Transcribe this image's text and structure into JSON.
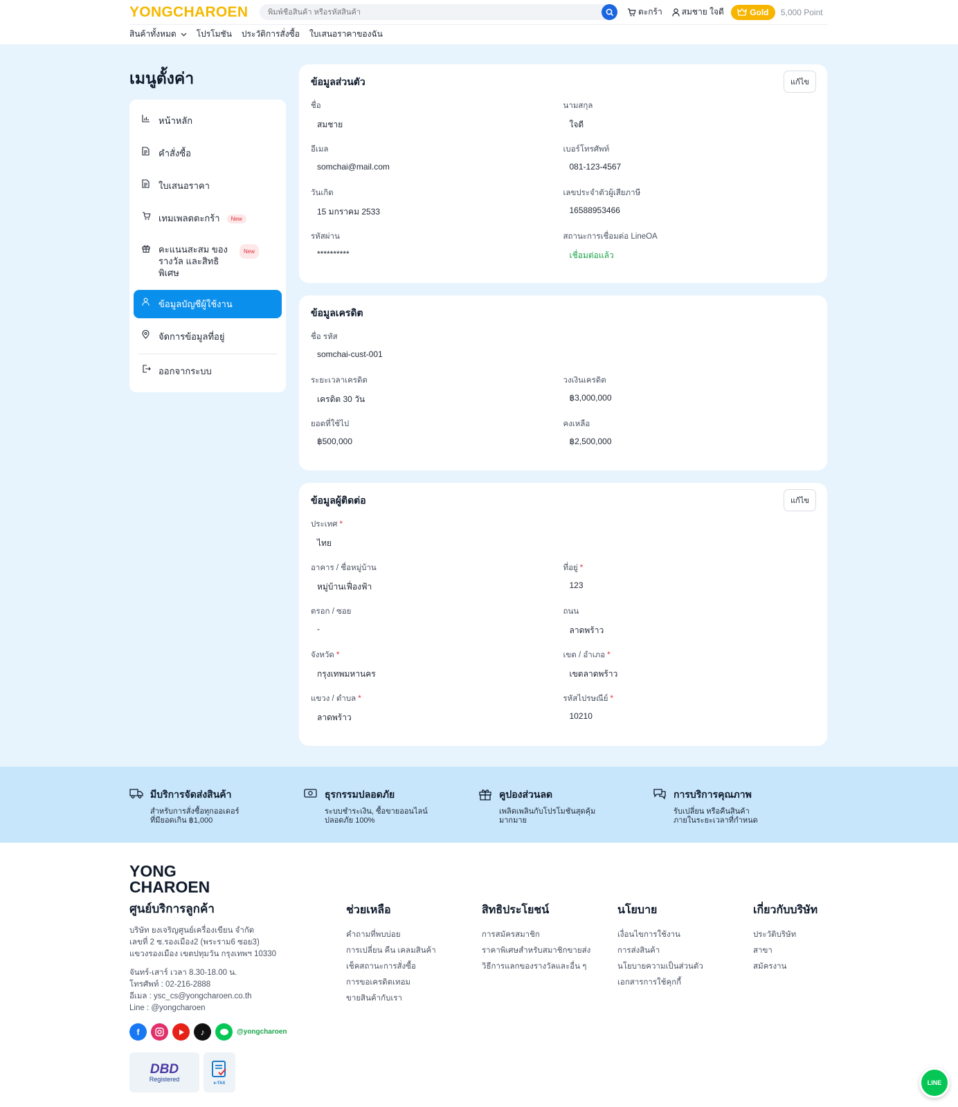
{
  "header": {
    "logo": "YONGCHAROEN",
    "search_placeholder": "พิมพ์ชื่อสินค้า หรือรหัสสินค้า",
    "cart_label": "ตะกร้า",
    "user_name": "สมชาย ใจดี",
    "tier": "Gold",
    "points": "5,000 Point",
    "nav": [
      "สินค้าทั้งหมด",
      "โปรโมชัน",
      "ประวัติการสั่งซื้อ",
      "ใบเสนอราคาของฉัน"
    ]
  },
  "sidebar": {
    "title": "เมนูตั้งค่า",
    "items": [
      {
        "label": "หน้าหลัก"
      },
      {
        "label": "คำสั่งซื้อ"
      },
      {
        "label": "ใบเสนอราคา"
      },
      {
        "label": "เทมเพลตตะกร้า",
        "badge": "New"
      },
      {
        "label": "คะแนนสะสม ของรางวัล และสิทธิพิเศษ",
        "badge": "New"
      },
      {
        "label": "ข้อมูลบัญชีผู้ใช้งาน"
      },
      {
        "label": "จัดการข้อมูลที่อยู่"
      },
      {
        "label": "ออกจากระบบ"
      }
    ]
  },
  "personal": {
    "title": "ข้อมูลส่วนตัว",
    "edit": "แก้ไข",
    "fields": [
      {
        "label": "ชื่อ",
        "value": "สมชาย"
      },
      {
        "label": "นามสกุล",
        "value": "ใจดี"
      },
      {
        "label": "อีเมล",
        "value": "somchai@mail.com"
      },
      {
        "label": "เบอร์โทรศัพท์",
        "value": "081-123-4567"
      },
      {
        "label": "วันเกิด",
        "value": "15 มกราคม 2533"
      },
      {
        "label": "เลขประจำตัวผู้เสียภาษี",
        "value": "16588953466"
      },
      {
        "label": "รหัสผ่าน",
        "value": "**********"
      },
      {
        "label": "สถานะการเชื่อมต่อ LineOA",
        "value": "เชื่อมต่อแล้ว"
      }
    ]
  },
  "credit": {
    "title": "ข้อมูลเครดิต",
    "fields": [
      {
        "label": "ชื่อ รหัส",
        "value": "somchai-cust-001"
      },
      {
        "label": "ระยะเวลาเครดิต",
        "value": "เครดิต 30 วัน"
      },
      {
        "label": "วงเงินเครดิต",
        "value": "฿3,000,000"
      },
      {
        "label": "ยอดที่ใช้ไป",
        "value": "฿500,000"
      },
      {
        "label": "คงเหลือ",
        "value": "฿2,500,000"
      }
    ]
  },
  "contact": {
    "title": "ข้อมูลผู้ติดต่อ",
    "edit": "แก้ไข",
    "required_mark": "*",
    "fields": [
      {
        "label": "ประเทศ",
        "value": "ไทย"
      },
      {
        "label": "อาคาร / ชื่อหมู่บ้าน",
        "value": "หมู่บ้านเฟื่องฟ้า"
      },
      {
        "label": "ที่อยู่",
        "value": "123"
      },
      {
        "label": "ตรอก / ซอย",
        "value": "-"
      },
      {
        "label": "ถนน",
        "value": "ลาดพร้าว"
      },
      {
        "label": "จังหวัด",
        "value": "กรุงเทพมหานคร"
      },
      {
        "label": "เขต / อำเภอ",
        "value": "เขตลาดพร้าว"
      },
      {
        "label": "แขวง / ตำบล",
        "value": "ลาดพร้าว"
      },
      {
        "label": "รหัสไปรษณีย์",
        "value": "10210"
      }
    ]
  },
  "features": [
    {
      "title": "มีบริการจัดส่งสินค้า",
      "line1": "สำหรับการสั่งซื้อทุกออเดอร์",
      "line2": "ที่มียอดเกิน ฿1,000"
    },
    {
      "title": "ธุรกรรมปลอดภัย",
      "line1": "ระบบชำระเงิน, ซื้อขายออนไลน์",
      "line2": "ปลอดภัย 100%"
    },
    {
      "title": "คูปองส่วนลด",
      "line1": "เพลิดเพลินกับโปรโมชันสุดคุ้ม",
      "line2": "มากมาย"
    },
    {
      "title": "การบริการคุณภาพ",
      "line1": "รับเปลี่ยน หรือคืนสินค้า",
      "line2": "ภายในระยะเวลาที่กำหนด"
    }
  ],
  "footer": {
    "logo_line1": "YONG",
    "logo_line2": "CHAROEN",
    "service_title": "ศูนย์บริการลูกค้า",
    "address": [
      "บริษัท ยงเจริญศูนย์เครื่องเขียน จำกัด",
      "เลขที่ 2 ซ.รองเมือง2 (พระราม6 ซอย3)",
      "แขวงรองเมือง เขตปทุมวัน กรุงเทพฯ 10330"
    ],
    "contact": [
      "จันทร์-เสาร์ เวลา 8.30-18.00 น.",
      "โทรศัพท์ : 02-216-2888",
      "อีเมล : ysc_cs@yongcharoen.co.th",
      "Line : @yongcharoen"
    ],
    "social_handle": "@yongcharoen",
    "badge_dbd": "DBD",
    "badge_registered": "Registered",
    "badge_etax": "e-TAX",
    "columns": [
      {
        "title": "ช่วยเหลือ",
        "links": [
          "คำถามที่พบบ่อย",
          "การเปลี่ยน คืน เคลมสินค้า",
          "เช็คสถานะการสั่งซื้อ",
          "การขอเครดิตเทอม",
          "ขายสินค้ากับเรา"
        ]
      },
      {
        "title": "สิทธิประโยชน์",
        "links": [
          "การสมัครสมาชิก",
          "ราคาพิเศษสำหรับสมาชิกขายส่ง",
          "วิธีการแลกของรางวัลและอื่น ๆ"
        ]
      },
      {
        "title": "นโยบาย",
        "links": [
          "เงื่อนไขการใช้งาน",
          "การส่งสินค้า",
          "นโยบายความเป็นส่วนตัว",
          "เอกสารการใช้คุกกี้"
        ]
      },
      {
        "title": "เกี่ยวกับบริษัท",
        "links": [
          "ประวัติบริษัท",
          "สาขา",
          "สมัครงาน"
        ]
      }
    ],
    "line_fab": "LINE"
  },
  "colors": {
    "accent": "#0b8fec",
    "brand": "#f5b800",
    "success": "#1aa34a"
  }
}
